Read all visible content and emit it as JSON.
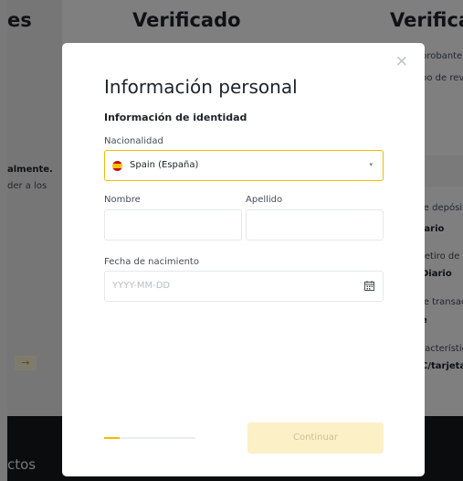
{
  "background": {
    "headings": [
      "es",
      "Verificado",
      "Verificad"
    ],
    "right_texts": [
      "probante",
      "po de rev",
      "le depósit",
      "iario",
      "retiro de",
      "Diario",
      "le transac",
      "e",
      "racterístic",
      "C/tarjeta d"
    ],
    "left_texts": [
      "almente.",
      "der a los"
    ],
    "arrow": "→",
    "footer_text": "ctos"
  },
  "modal": {
    "close_glyph": "×",
    "title": "Información personal",
    "section": "Información de identidad",
    "nationality": {
      "label": "Nacionalidad",
      "value": "Spain (España)",
      "caret": "▾"
    },
    "first_name": {
      "label": "Nombre",
      "value": ""
    },
    "last_name": {
      "label": "Apellido",
      "value": ""
    },
    "birth_date": {
      "label": "Fecha de nacimiento",
      "placeholder": "YYYY-MM-DD"
    },
    "progress": 0.17,
    "continue_label": "Continuar",
    "colors": {
      "accent": "#f0b90b",
      "button_disabled_bg": "#fcf0c6"
    }
  }
}
